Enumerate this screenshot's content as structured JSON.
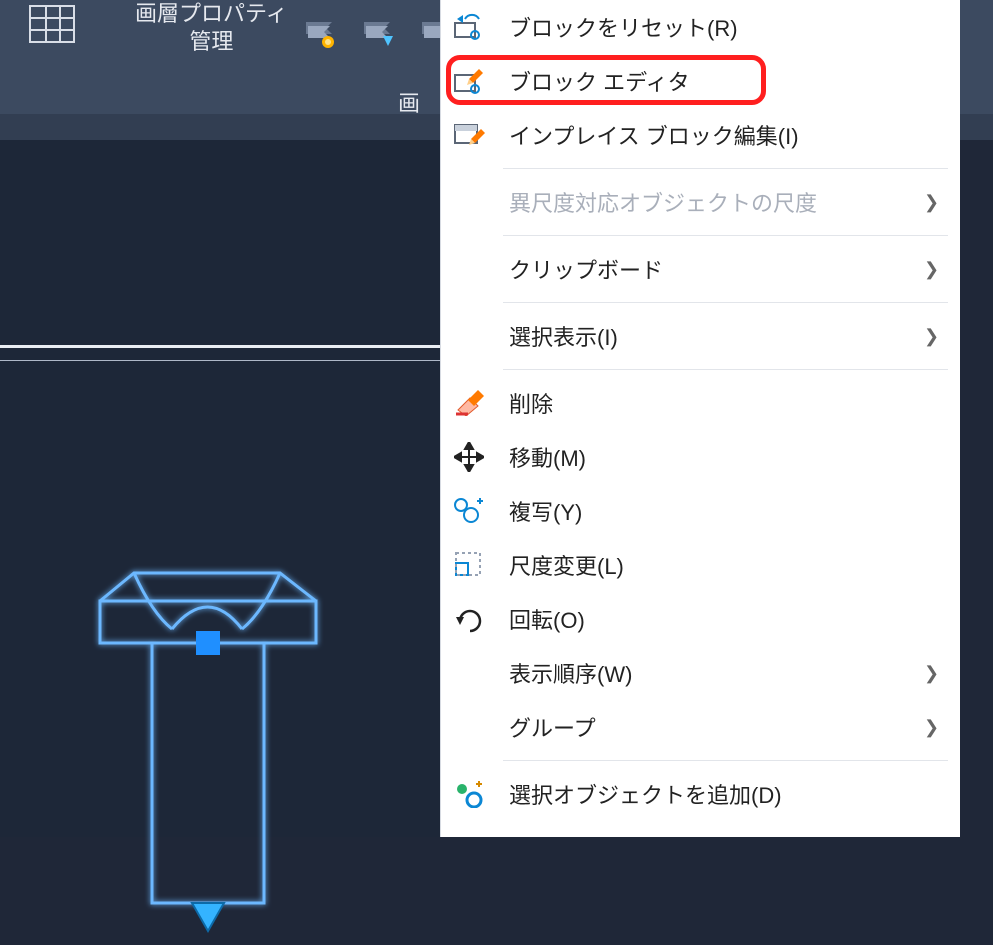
{
  "ribbon": {
    "layer_properties_label_line1": "画層プロパティ",
    "layer_properties_label_line2": "管理",
    "section_label2": "画"
  },
  "menu": {
    "reset_block": "ブロックをリセット(R)",
    "block_editor": "ブロック エディタ",
    "inplace_edit": "インプレイス ブロック編集(I)",
    "annotative_scale": "異尺度対応オブジェクトの尺度",
    "clipboard": "クリップボード",
    "isolate": "選択表示(I)",
    "erase": "削除",
    "move": "移動(M)",
    "copy": "複写(Y)",
    "scale": "尺度変更(L)",
    "rotate": "回転(O)",
    "draw_order": "表示順序(W)",
    "group": "グループ",
    "add_selected": "選択オブジェクトを追加(D)"
  }
}
